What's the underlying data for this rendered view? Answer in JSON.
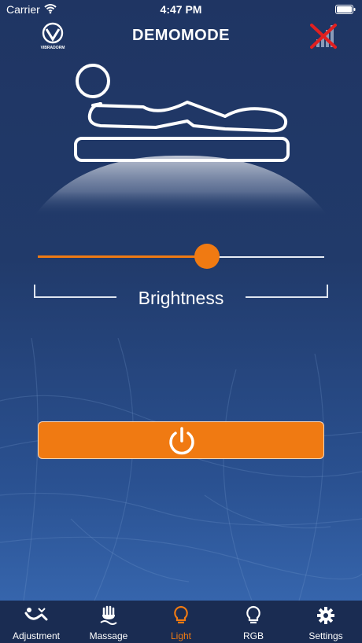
{
  "status_bar": {
    "carrier": "Carrier",
    "time": "4:47 PM"
  },
  "header": {
    "logo_text": "VIBRADORM",
    "title": "DEMOMODE"
  },
  "brightness": {
    "label": "Brightness",
    "value_fraction": 0.59
  },
  "power_button": {
    "icon": "power-icon"
  },
  "tabs": [
    {
      "label": "Adjustment",
      "icon": "bed-adjust-icon",
      "active": false
    },
    {
      "label": "Massage",
      "icon": "massage-icon",
      "active": false
    },
    {
      "label": "Light",
      "icon": "lightbulb-icon",
      "active": true
    },
    {
      "label": "RGB",
      "icon": "rgb-bulb-icon",
      "active": false
    },
    {
      "label": "Settings",
      "icon": "gear-icon",
      "active": false
    }
  ],
  "colors": {
    "accent": "#f07a12",
    "background_top": "#1f3563",
    "background_bottom": "#3a6cb6",
    "tab_bar": "#1a2c52",
    "disconnect_red": "#e02020"
  }
}
